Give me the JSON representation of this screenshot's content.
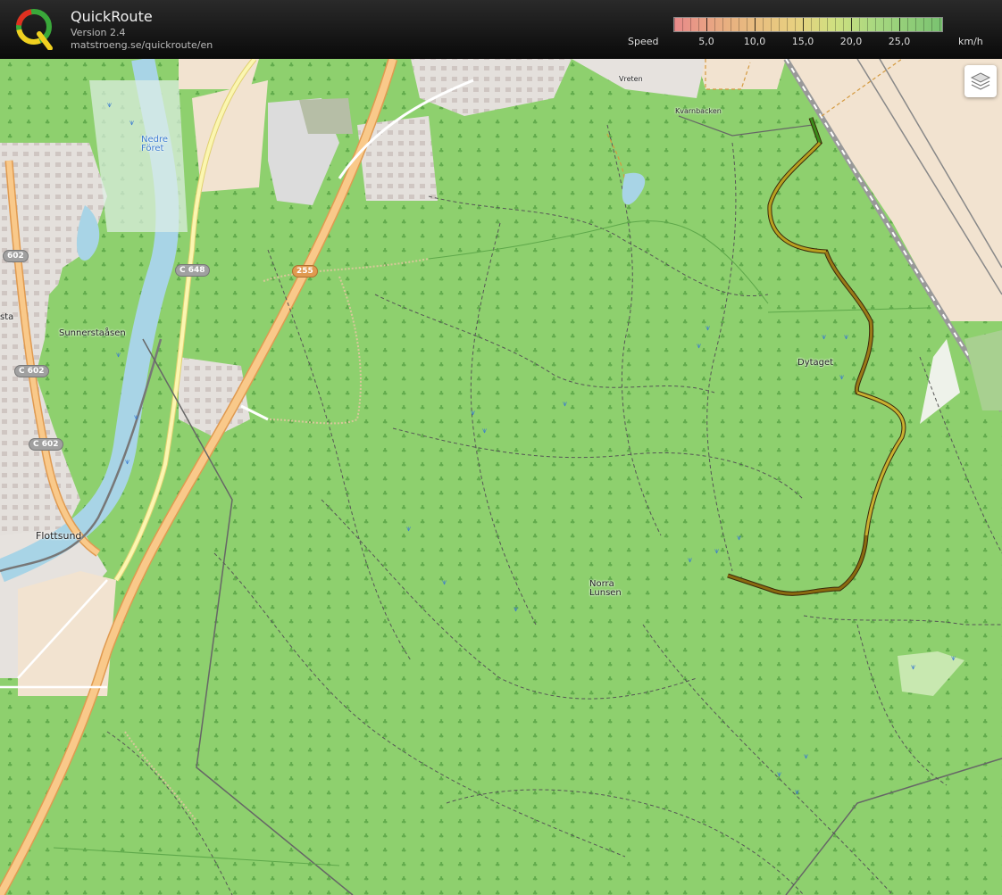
{
  "header": {
    "title": "QuickRoute",
    "version": "Version 2.4",
    "url": "matstroeng.se/quickroute/en"
  },
  "speed_scale": {
    "label": "Speed",
    "ticks": [
      "5,0",
      "10,0",
      "15,0",
      "20,0",
      "25,0"
    ],
    "unit": "km/h"
  },
  "map": {
    "places": {
      "nedre_foret": "Nedre\nFöret",
      "sunnerstaasen": "Sunnerstaåsen",
      "flottsund": "Flottsund",
      "sta": "sta",
      "norra_lunsen": "Norra\nLunsen",
      "dytaget": "Dytaget",
      "vreten": "Vreten",
      "kvarnbacken": "Kvarnbacken"
    },
    "shields": {
      "c602_a": "602",
      "c602_b": "C 602",
      "c602_c": "C 602",
      "c648": "C 648",
      "r255": "255"
    },
    "route_colors": {
      "slow": "#8a6a10",
      "mid": "#b8a020",
      "fast": "#3a8a1a"
    }
  },
  "controls": {
    "layers_icon": "layers-icon"
  }
}
